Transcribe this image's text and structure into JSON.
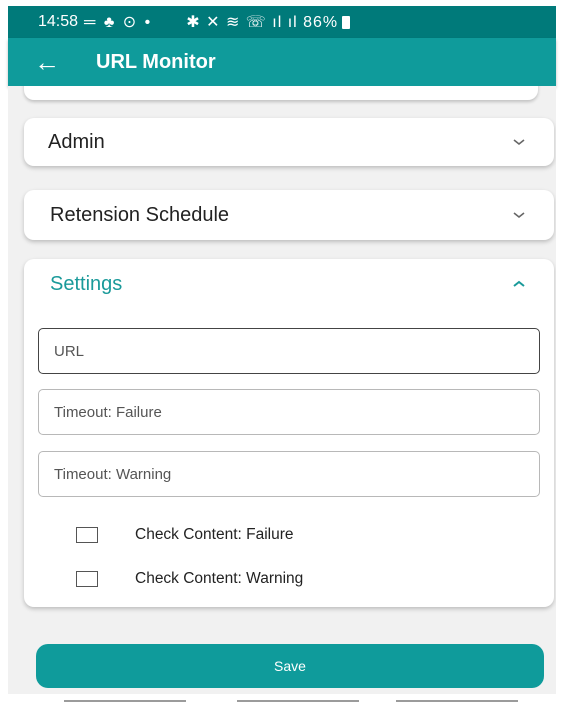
{
  "status_bar": {
    "time": "14:58",
    "left_glyphs": "═ ♣ ⊙ •",
    "right_status": "✱ ✕ ≋ ☏ ıl ıl 86%",
    "battery_icon": "battery-icon"
  },
  "app_bar": {
    "back_glyph": "←",
    "title": "URL Monitor"
  },
  "panels": {
    "admin": {
      "title": "Admin",
      "expanded": false
    },
    "retension": {
      "title": "Retension Schedule",
      "expanded": false
    },
    "settings": {
      "title": "Settings",
      "expanded": true,
      "fields": {
        "url": {
          "placeholder": "URL",
          "value": ""
        },
        "timeout_failure": {
          "placeholder": "Timeout: Failure",
          "value": ""
        },
        "timeout_warning": {
          "placeholder": "Timeout: Warning",
          "value": ""
        }
      },
      "checkboxes": {
        "check_failure": {
          "label": "Check Content: Failure",
          "checked": false
        },
        "check_warning": {
          "label": "Check Content: Warning",
          "checked": false
        }
      }
    }
  },
  "actions": {
    "save_label": "Save"
  },
  "colors": {
    "primary": "#0f9b9b",
    "status_bar": "#007a7a",
    "accent_text": "#1a9a9a",
    "background": "#f1f1f1"
  }
}
